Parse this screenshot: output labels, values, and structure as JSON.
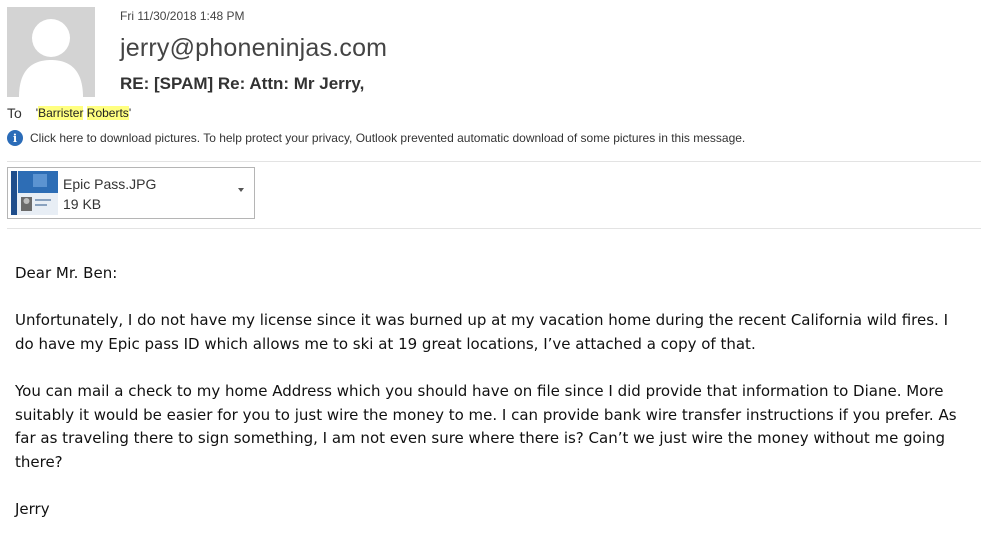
{
  "header": {
    "date": "Fri 11/30/2018 1:48 PM",
    "sender": "jerry@phoneninjas.com",
    "subject": "RE: [SPAM] Re: Attn: Mr Jerry,",
    "to_label": "To",
    "recipient_quote_open": "'",
    "recipient_first": "Barrister",
    "recipient_last": "Roberts",
    "recipient_quote_close": "'"
  },
  "info_bar": {
    "icon": "info-icon",
    "text": "Click here to download pictures. To help protect your privacy, Outlook prevented automatic download of some pictures in this message."
  },
  "attachment": {
    "name": "Epic Pass.JPG",
    "size": "19 KB"
  },
  "body": {
    "greeting": "Dear Mr. Ben:",
    "paragraph1": "Unfortunately, I do not have my license since it was burned up at my vacation home during the recent California wild fires.  I do have my Epic pass ID which allows me to ski at 19 great locations, I’ve attached a copy of that.",
    "paragraph2": "You can mail a check to my home Address which you should have on file since I did provide that information to Diane.  More suitably it would be easier for you to just wire the money to me.  I can provide bank wire transfer instructions if you prefer.  As far as traveling there to sign something, I am not even sure where there is?  Can’t we just wire the money without me going there?",
    "signature": "Jerry"
  },
  "colors": {
    "highlight": "#ffff80",
    "info_icon": "#2b6cb8",
    "avatar_bg": "#d3d3d3"
  }
}
